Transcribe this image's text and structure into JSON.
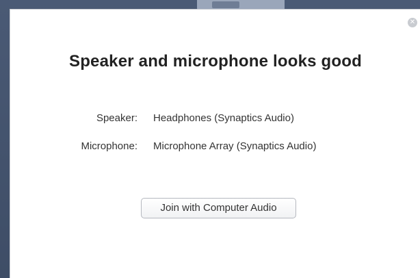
{
  "dialog": {
    "title": "Speaker and microphone looks good",
    "close_icon_glyph": "✕",
    "speaker": {
      "label": "Speaker:",
      "value": "Headphones (Synaptics Audio)"
    },
    "microphone": {
      "label": "Microphone:",
      "value": "Microphone Array (Synaptics Audio)"
    },
    "join_button_label": "Join with Computer Audio"
  },
  "colors": {
    "backdrop": "#4a5a75",
    "dialog_bg": "#ffffff",
    "title_text": "#222222",
    "body_text": "#333333",
    "close_icon_bg": "#c9ccd1",
    "button_border": "#b5b8bf"
  },
  "icons": {
    "close": "close-icon"
  }
}
